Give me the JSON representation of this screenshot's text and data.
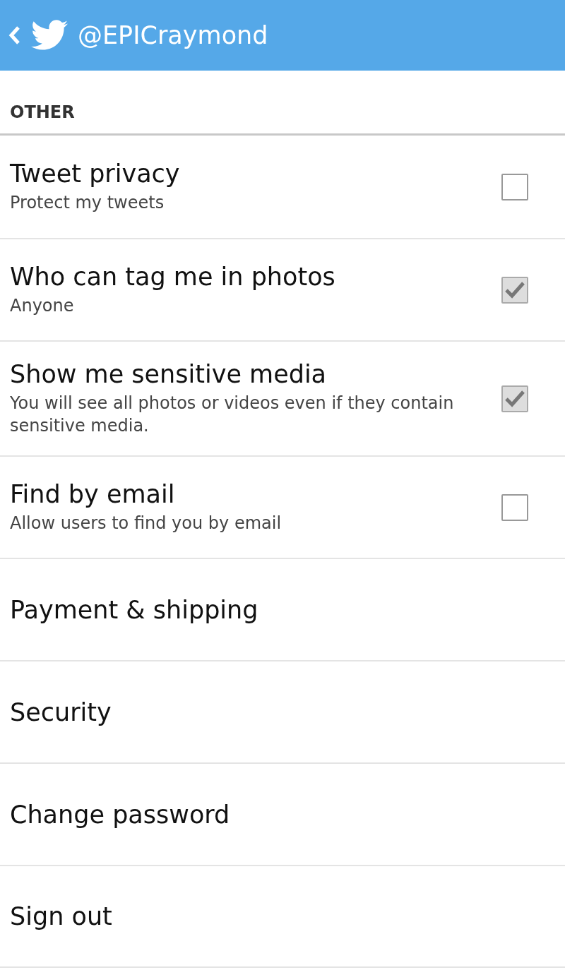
{
  "header": {
    "title": "@EPICraymond"
  },
  "section": {
    "title": "OTHER"
  },
  "items": [
    {
      "kind": "checkbox",
      "title": "Tweet privacy",
      "subtitle": "Protect my tweets",
      "checked": false
    },
    {
      "kind": "checkbox",
      "title": "Who can tag me in photos",
      "subtitle": "Anyone",
      "checked": true
    },
    {
      "kind": "checkbox",
      "title": "Show me sensitive media",
      "subtitle": "You will see all photos or videos even if they contain sensitive media.",
      "checked": true
    },
    {
      "kind": "checkbox",
      "title": "Find by email",
      "subtitle": "Allow users to find you by email",
      "checked": false
    },
    {
      "kind": "link",
      "title": "Payment & shipping"
    },
    {
      "kind": "link",
      "title": "Security"
    },
    {
      "kind": "link",
      "title": "Change password"
    },
    {
      "kind": "link",
      "title": "Sign out"
    }
  ]
}
